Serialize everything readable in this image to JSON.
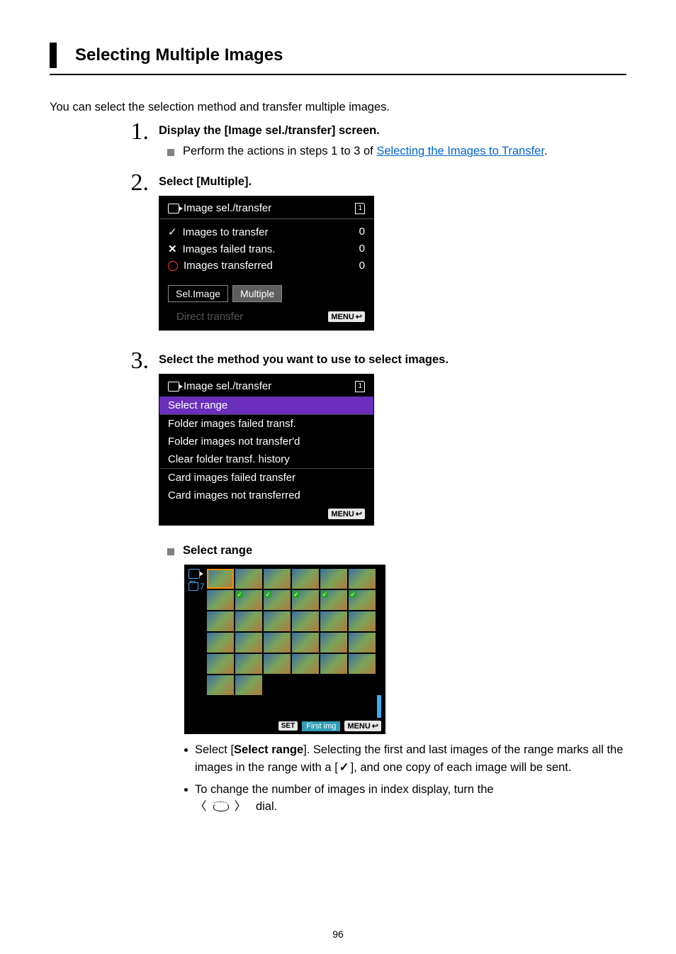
{
  "heading": "Selecting Multiple Images",
  "intro": "You can select the selection method and transfer multiple images.",
  "steps": {
    "s1": {
      "num": "1.",
      "title": "Display the [Image sel./transfer] screen.",
      "bullet_pre": "Perform the actions in steps 1 to 3 of ",
      "bullet_link": "Selecting the Images to Transfer",
      "bullet_post": "."
    },
    "s2": {
      "num": "2.",
      "title": "Select [Multiple].",
      "screen": {
        "header": "Image sel./transfer",
        "card": "1",
        "rows": {
          "r1": {
            "label": "Images to transfer",
            "value": "0"
          },
          "r2": {
            "label": "Images failed trans.",
            "value": "0"
          },
          "r3": {
            "label": "Images transferred",
            "value": "0"
          }
        },
        "btn1": "Sel.Image",
        "btn2": "Multiple",
        "direct": "Direct transfer",
        "menu": "MENU"
      }
    },
    "s3": {
      "num": "3.",
      "title": "Select the method you want to use to select images.",
      "screen": {
        "header": "Image sel./transfer",
        "card": "1",
        "items": {
          "i0": "Select range",
          "i1": "Folder images failed transf.",
          "i2": "Folder images not transfer'd",
          "i3": "Clear folder transf. history",
          "i4": "Card images failed transfer",
          "i5": "Card images not transferred"
        },
        "menu": "MENU"
      },
      "sub": {
        "title": "Select range",
        "thumb_footer": {
          "set": "SET",
          "label": "First img",
          "menu": "MENU"
        },
        "folder_label": "7",
        "desc1_pre": "Select [",
        "desc1_bold": "Select range",
        "desc1_mid": "]. Selecting the first and last images of the range marks all the images in the range with a [",
        "desc1_check": "✓",
        "desc1_post": "], and one copy of each image will be sent.",
        "desc2_pre": "To change the number of images in index display, turn the ",
        "desc2_post": " dial."
      }
    }
  },
  "page_number": "96"
}
